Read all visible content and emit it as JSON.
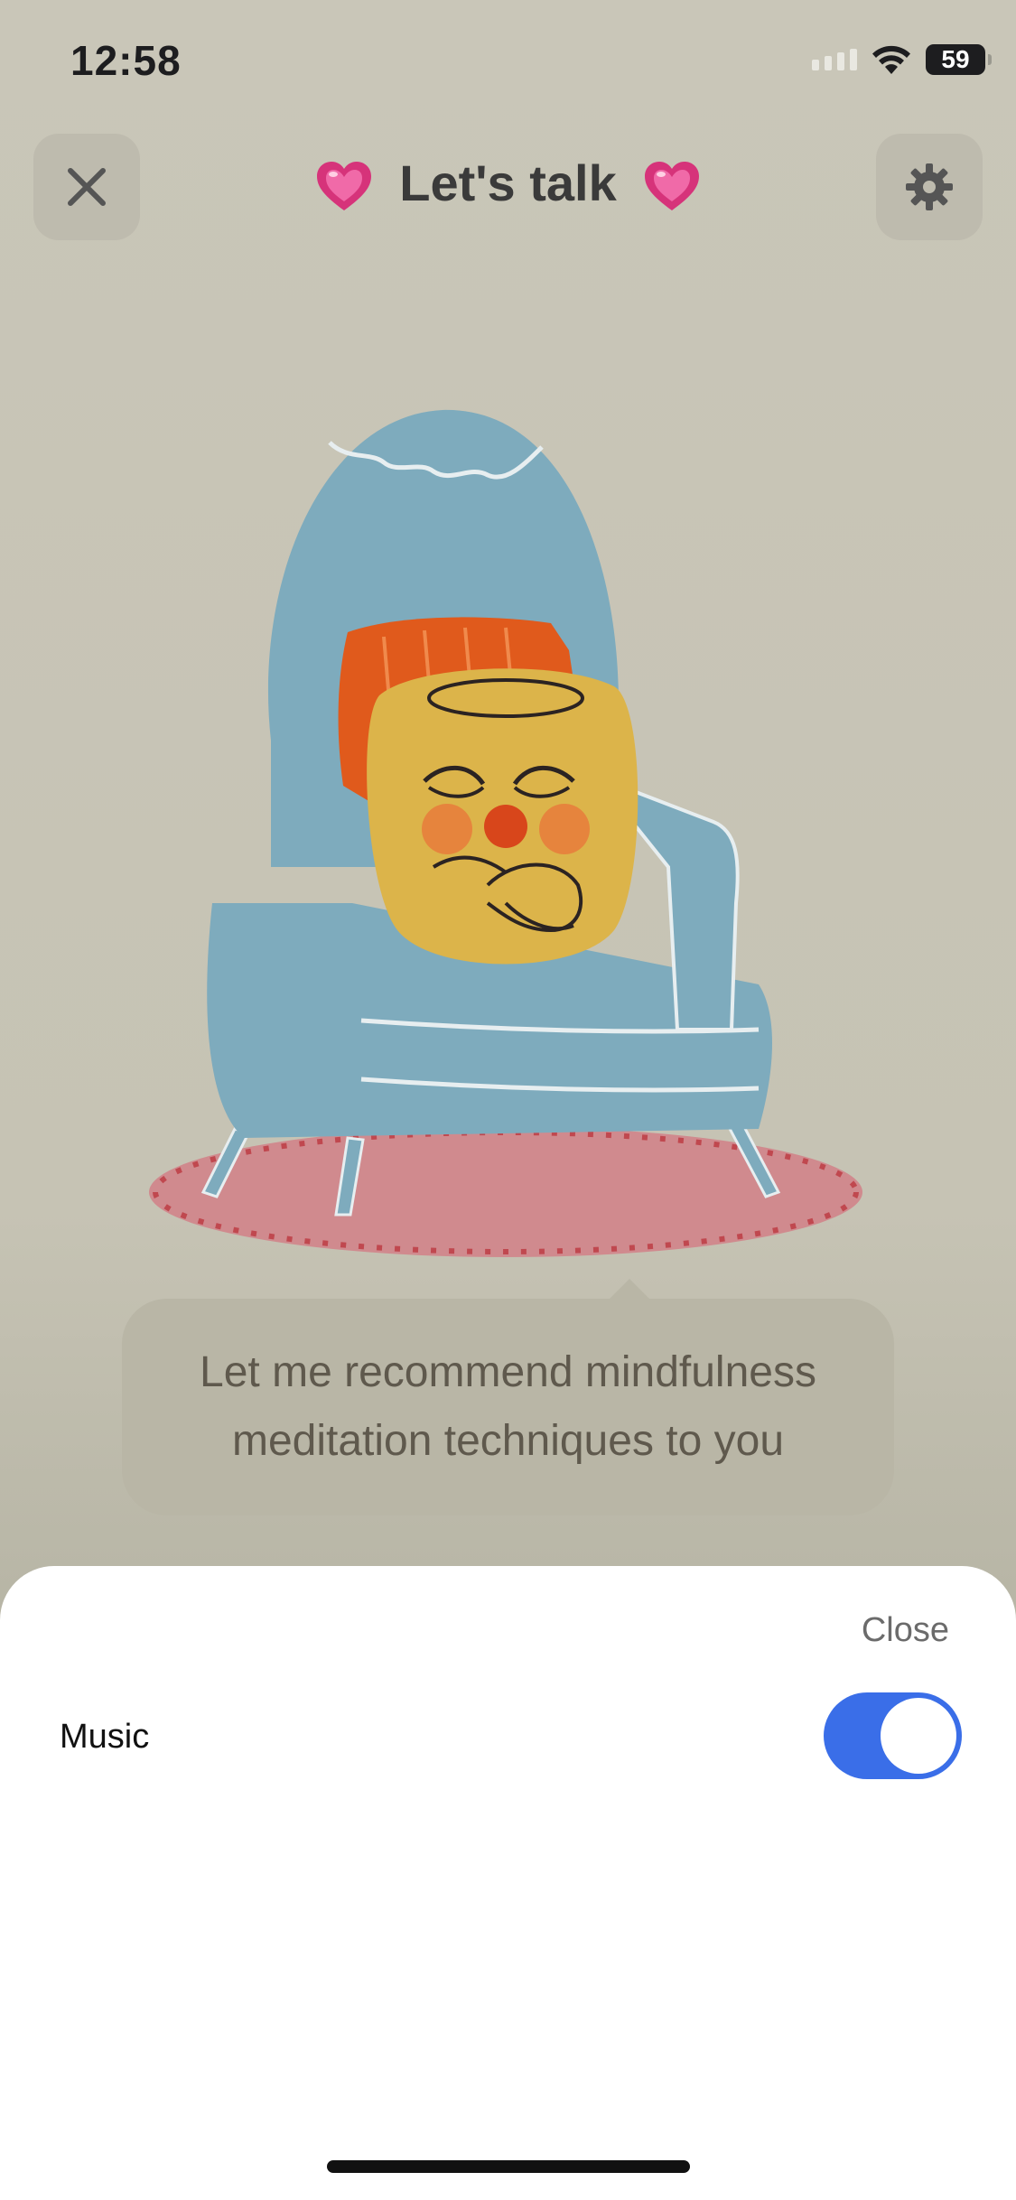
{
  "status_bar": {
    "time": "12:58",
    "battery": "59"
  },
  "header": {
    "title": "Let's talk",
    "close_icon": "close-icon",
    "settings_icon": "gear-icon",
    "emoji_icon": "pink-heart-icon"
  },
  "illustration": {
    "description_icon": "character-on-armchair-illustration"
  },
  "bubble": {
    "line1": "Let me recommend mindfulness",
    "line2": "meditation techniques to you"
  },
  "sheet": {
    "close_label": "Close",
    "music_label": "Music",
    "music_enabled": true
  },
  "colors": {
    "background": "#c9c6b8",
    "toggle_on": "#3a6ee8",
    "chair": "#7eabbd",
    "rug": "#d08a8e",
    "character": "#dcb44a",
    "pillow": "#e05a1c"
  }
}
